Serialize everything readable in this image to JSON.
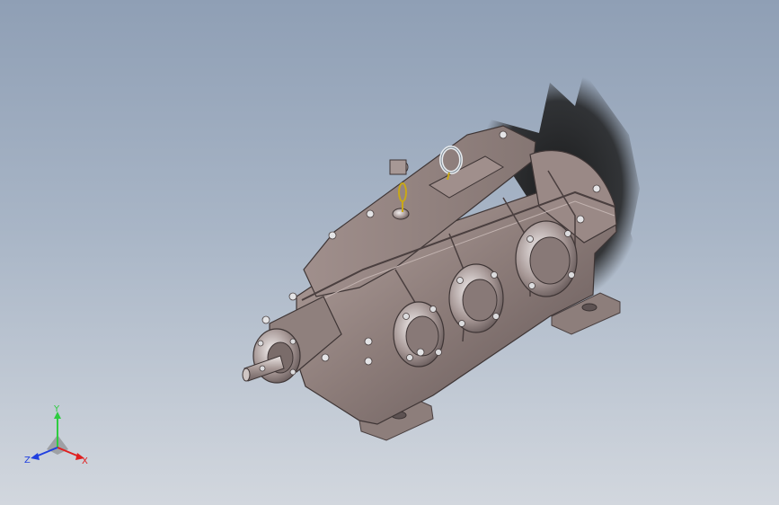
{
  "model": {
    "name": "gear-reducer",
    "body_color": "#8a7a77",
    "body_dark": "#6d6060",
    "body_light": "#b9a8a5",
    "bolt_color": "#d9d9db",
    "shadow_color": "#1c1c1c"
  },
  "triad": {
    "y_label": "Y",
    "z_label": "Z",
    "x_label": "X",
    "y_color": "#2ecc40",
    "z_color": "#2040e0",
    "x_color": "#e02020"
  }
}
